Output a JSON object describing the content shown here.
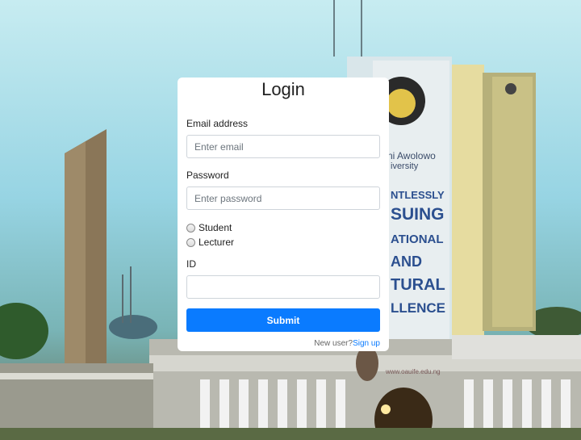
{
  "background": {
    "building_lines": [
      "ni Awolowo",
      "iversity",
      "NTLESSLY",
      "SUING",
      "ATIONAL",
      "AND",
      "TURAL",
      "LLENCE"
    ],
    "website": "www.oauife.edu.ng"
  },
  "login": {
    "title": "Login",
    "email_label": "Email address",
    "email_placeholder": "Enter email",
    "password_label": "Password",
    "password_placeholder": "Enter password",
    "role_options": [
      "Student",
      "Lecturer"
    ],
    "id_label": "ID",
    "id_value": "",
    "submit_label": "Submit",
    "new_user_text": "New user?",
    "signup_link": "Sign up"
  },
  "colors": {
    "accent": "#0a7bff",
    "card": "#ffffff"
  }
}
